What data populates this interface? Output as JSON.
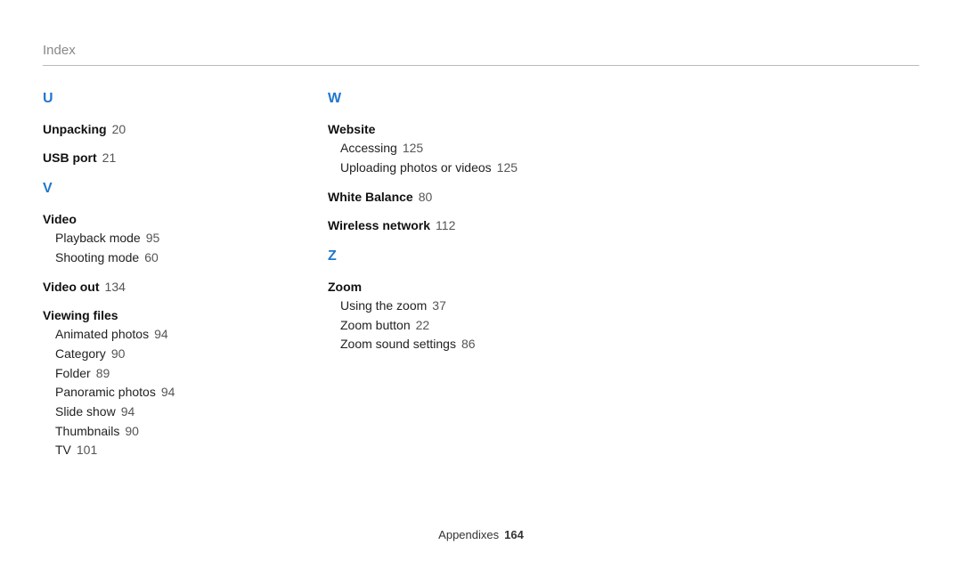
{
  "page_title": "Index",
  "footer": {
    "section": "Appendixes",
    "page": "164"
  },
  "col1": {
    "U": {
      "letter": "U"
    },
    "unpacking": {
      "label": "Unpacking",
      "page": "20"
    },
    "usb_port": {
      "label": "USB port",
      "page": "21"
    },
    "V": {
      "letter": "V"
    },
    "video": {
      "label": "Video"
    },
    "video_playback": {
      "label": "Playback mode",
      "page": "95"
    },
    "video_shooting": {
      "label": "Shooting mode",
      "page": "60"
    },
    "video_out": {
      "label": "Video out",
      "page": "134"
    },
    "viewing_files": {
      "label": "Viewing files"
    },
    "vf_animated": {
      "label": "Animated photos",
      "page": "94"
    },
    "vf_category": {
      "label": "Category",
      "page": "90"
    },
    "vf_folder": {
      "label": "Folder",
      "page": "89"
    },
    "vf_panoramic": {
      "label": "Panoramic photos",
      "page": "94"
    },
    "vf_slideshow": {
      "label": "Slide show",
      "page": "94"
    },
    "vf_thumbnails": {
      "label": "Thumbnails",
      "page": "90"
    },
    "vf_tv": {
      "label": "TV",
      "page": "101"
    }
  },
  "col2": {
    "W": {
      "letter": "W"
    },
    "website": {
      "label": "Website"
    },
    "ws_accessing": {
      "label": "Accessing",
      "page": "125"
    },
    "ws_uploading": {
      "label": "Uploading photos or videos",
      "page": "125"
    },
    "white_balance": {
      "label": "White Balance",
      "page": "80"
    },
    "wireless_network": {
      "label": "Wireless network",
      "page": "112"
    },
    "Z": {
      "letter": "Z"
    },
    "zoom": {
      "label": "Zoom"
    },
    "zoom_using": {
      "label": "Using the zoom",
      "page": "37"
    },
    "zoom_button": {
      "label": "Zoom button",
      "page": "22"
    },
    "zoom_sound": {
      "label": "Zoom sound settings",
      "page": "86"
    }
  }
}
